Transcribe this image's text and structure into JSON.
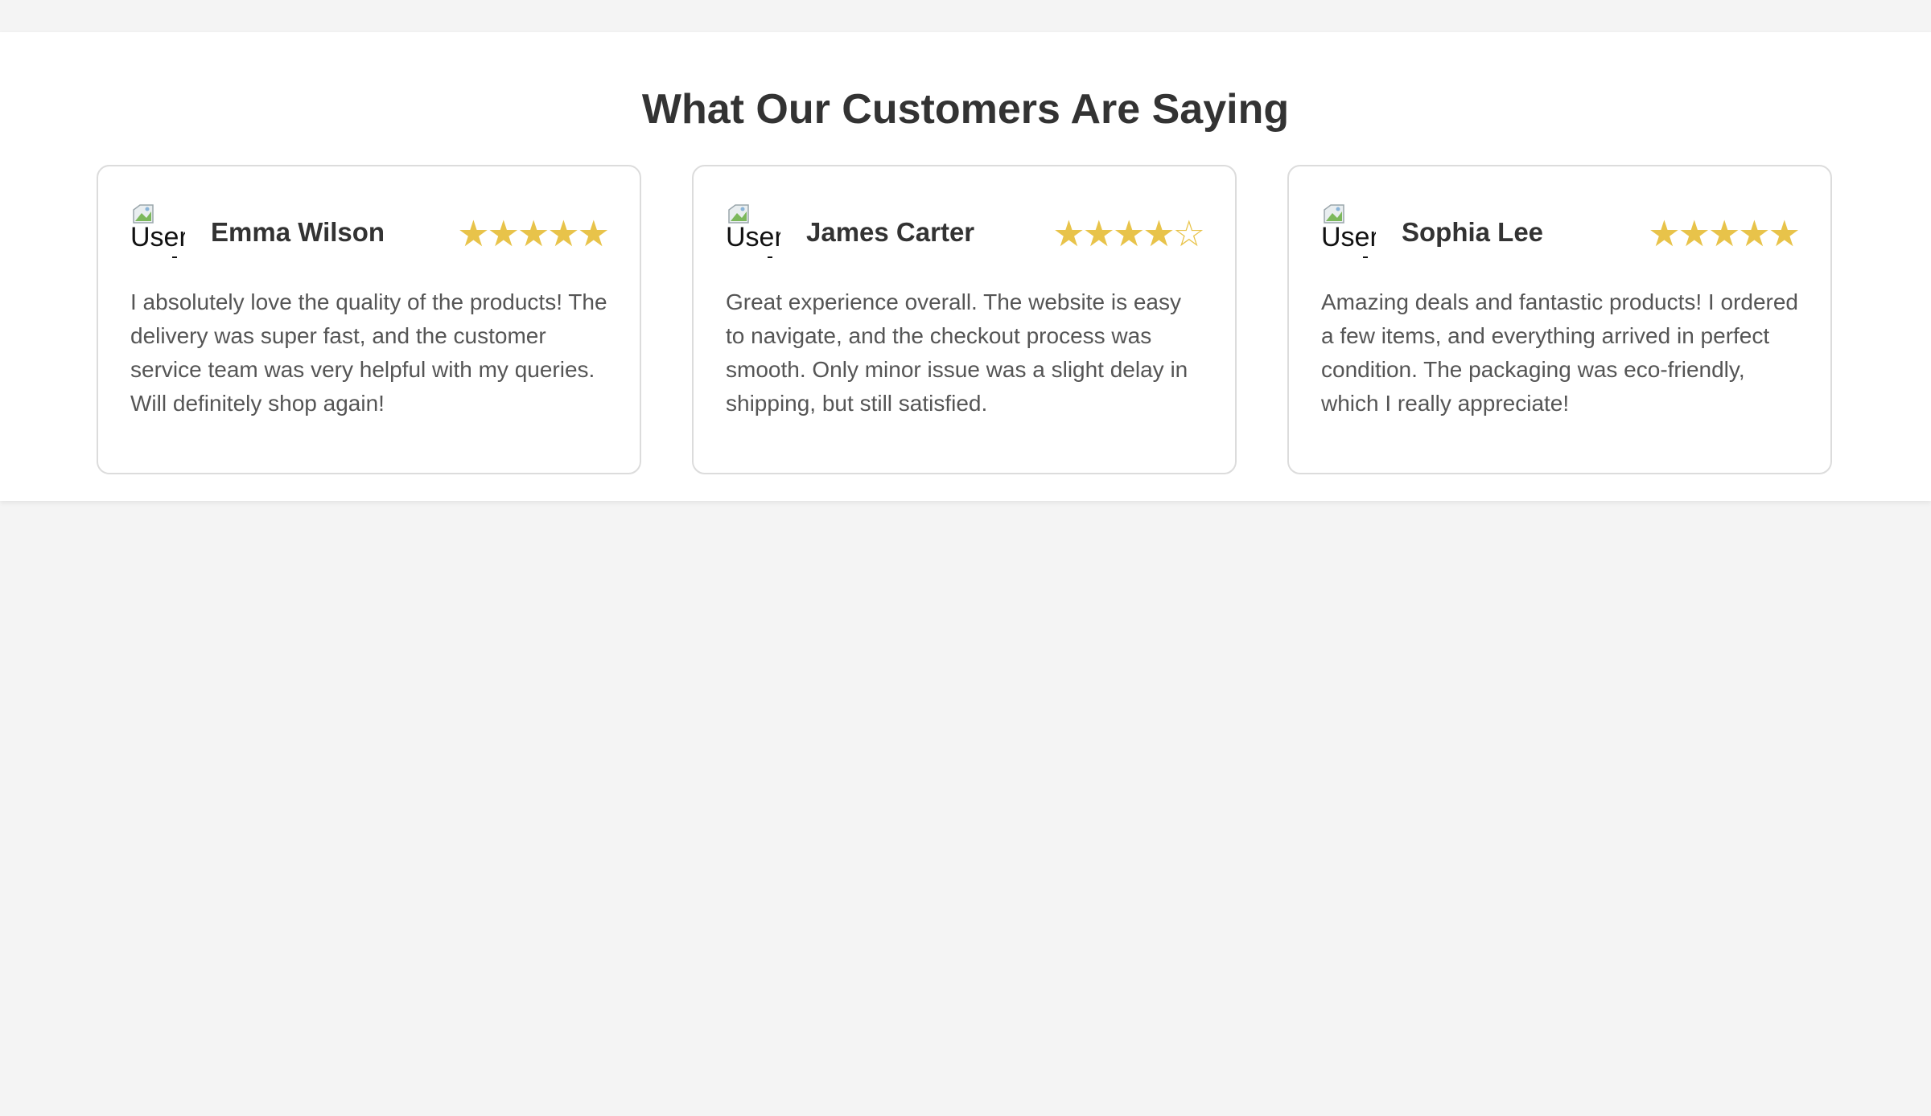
{
  "section": {
    "heading": "What Our Customers Are Saying"
  },
  "theme": {
    "star_color": "#e8c34a",
    "text_color": "#333333",
    "body_text_color": "#555555",
    "card_border": "#dcdcdc",
    "page_background": "#f4f4f4"
  },
  "testimonials": [
    {
      "avatar_alt": "User",
      "name": "Emma Wilson",
      "rating": 5,
      "rating_max": 5,
      "stars": "★★★★★",
      "review": "I absolutely love the quality of the products! The delivery was super fast, and the customer service team was very helpful with my queries. Will definitely shop again!"
    },
    {
      "avatar_alt": "User",
      "name": "James Carter",
      "rating": 4,
      "rating_max": 5,
      "stars": "★★★★☆",
      "review": "Great experience overall. The website is easy to navigate, and the checkout process was smooth. Only minor issue was a slight delay in shipping, but still satisfied."
    },
    {
      "avatar_alt": "User",
      "name": "Sophia Lee",
      "rating": 5,
      "rating_max": 5,
      "stars": "★★★★★",
      "review": "Amazing deals and fantastic products! I ordered a few items, and everything arrived in perfect condition. The packaging was eco-friendly, which I really appreciate!"
    }
  ]
}
